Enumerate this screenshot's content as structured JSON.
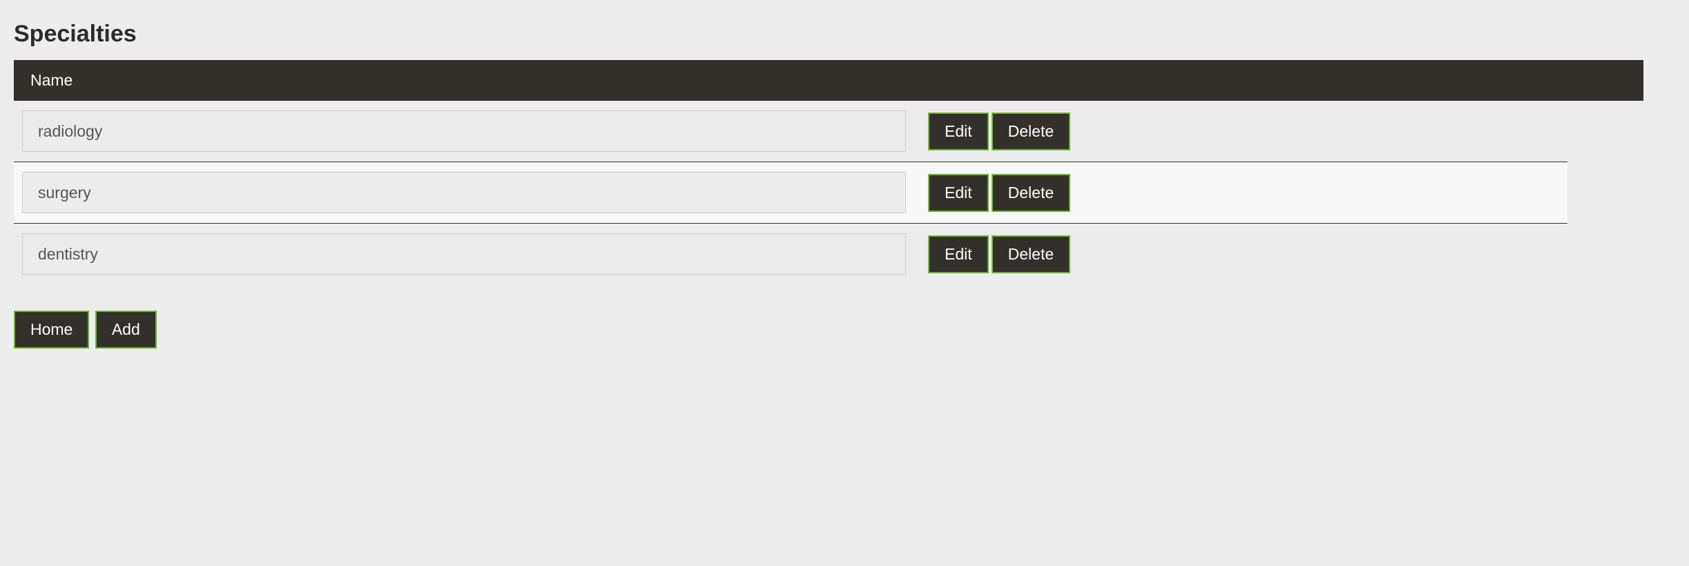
{
  "page": {
    "title": "Specialties"
  },
  "table": {
    "header": "Name",
    "rows": [
      {
        "name": "radiology",
        "edit_label": "Edit",
        "delete_label": "Delete"
      },
      {
        "name": "surgery",
        "edit_label": "Edit",
        "delete_label": "Delete"
      },
      {
        "name": "dentistry",
        "edit_label": "Edit",
        "delete_label": "Delete"
      }
    ]
  },
  "actions": {
    "home_label": "Home",
    "add_label": "Add"
  }
}
